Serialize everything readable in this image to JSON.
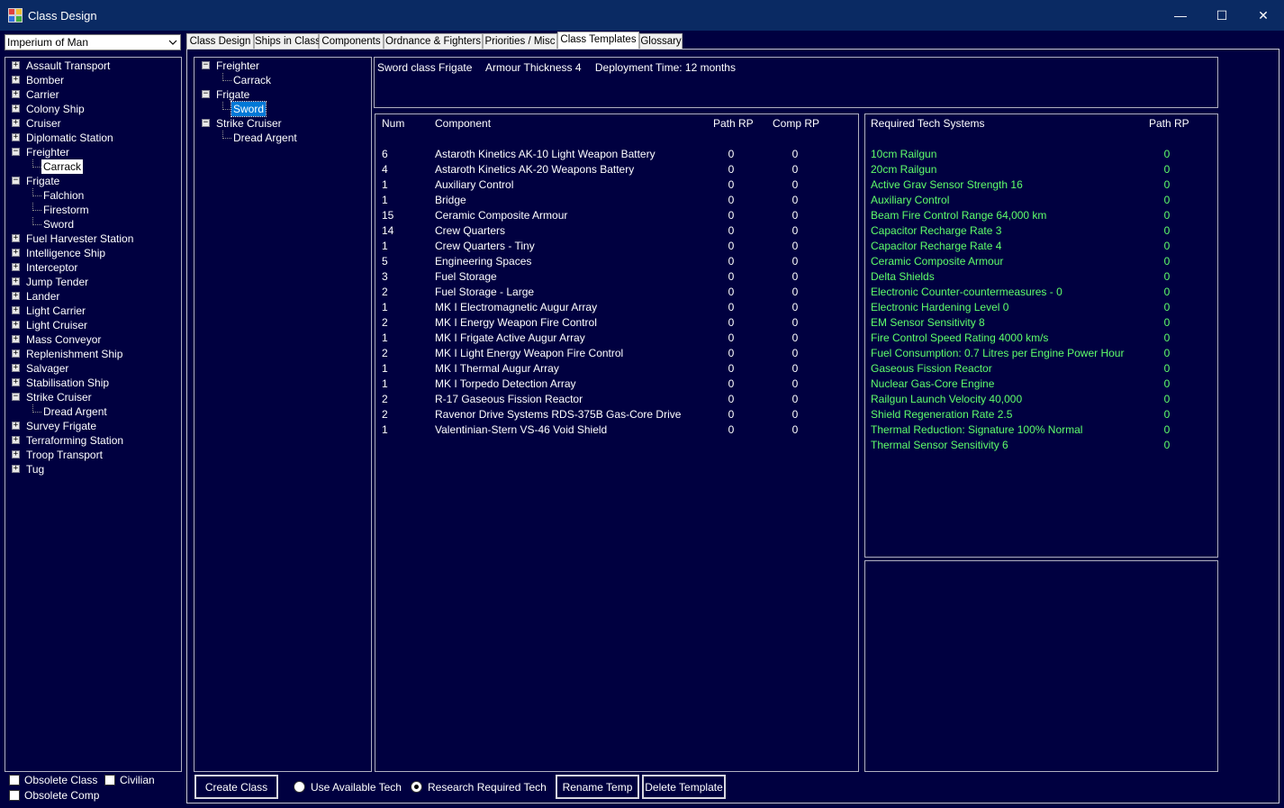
{
  "window": {
    "title": "Class Design",
    "minimize_glyph": "—",
    "maximize_glyph": "☐",
    "close_glyph": "✕"
  },
  "faction_select": {
    "value": "Imperium of Man",
    "arrow": "⌄"
  },
  "left_tree": [
    {
      "label": "Assault Transport",
      "expanded": false,
      "children": []
    },
    {
      "label": "Bomber",
      "expanded": false,
      "children": []
    },
    {
      "label": "Carrier",
      "expanded": false,
      "children": []
    },
    {
      "label": "Colony Ship",
      "expanded": false,
      "children": []
    },
    {
      "label": "Cruiser",
      "expanded": false,
      "children": []
    },
    {
      "label": "Diplomatic Station",
      "expanded": false,
      "children": []
    },
    {
      "label": "Freighter",
      "expanded": true,
      "children": [
        "Carrack"
      ]
    },
    {
      "label": "Frigate",
      "expanded": true,
      "children": [
        "Falchion",
        "Firestorm",
        "Sword"
      ]
    },
    {
      "label": "Fuel Harvester Station",
      "expanded": false,
      "children": []
    },
    {
      "label": "Intelligence Ship",
      "expanded": false,
      "children": []
    },
    {
      "label": "Interceptor",
      "expanded": false,
      "children": []
    },
    {
      "label": "Jump Tender",
      "expanded": false,
      "children": []
    },
    {
      "label": "Lander",
      "expanded": false,
      "children": []
    },
    {
      "label": "Light Carrier",
      "expanded": false,
      "children": []
    },
    {
      "label": "Light Cruiser",
      "expanded": false,
      "children": []
    },
    {
      "label": "Mass Conveyor",
      "expanded": false,
      "children": []
    },
    {
      "label": "Replenishment Ship",
      "expanded": false,
      "children": []
    },
    {
      "label": "Salvager",
      "expanded": false,
      "children": []
    },
    {
      "label": "Stabilisation Ship",
      "expanded": false,
      "children": []
    },
    {
      "label": "Strike Cruiser",
      "expanded": true,
      "children": [
        "Dread Argent"
      ]
    },
    {
      "label": "Survey Frigate",
      "expanded": false,
      "children": []
    },
    {
      "label": "Terraforming Station",
      "expanded": false,
      "children": []
    },
    {
      "label": "Troop Transport",
      "expanded": false,
      "children": []
    },
    {
      "label": "Tug",
      "expanded": false,
      "children": []
    }
  ],
  "left_selected": "Carrack",
  "bottom_checks": {
    "obsolete_class": "Obsolete Class",
    "civilian": "Civilian",
    "obsolete_comp": "Obsolete Comp"
  },
  "tabs": [
    "Class Design",
    "Ships in Class",
    "Components",
    "Ordnance & Fighters",
    "Priorities / Misc",
    "Class Templates",
    "Glossary"
  ],
  "active_tab": "Class Templates",
  "template_tree": [
    {
      "label": "Freighter",
      "children": [
        "Carrack"
      ]
    },
    {
      "label": "Frigate",
      "children": [
        "Sword"
      ]
    },
    {
      "label": "Strike Cruiser",
      "children": [
        "Dread Argent"
      ]
    }
  ],
  "template_selected": "Sword",
  "summary": {
    "class_name": "Sword class Frigate",
    "armour": "Armour Thickness 4",
    "deployment": "Deployment Time: 12 months"
  },
  "components_table": {
    "headers": [
      "Num",
      "Component",
      "Path RP",
      "Comp RP"
    ],
    "rows": [
      [
        "6",
        "Astaroth Kinetics AK-10 Light Weapon Battery",
        "0",
        "0"
      ],
      [
        "4",
        "Astaroth Kinetics AK-20 Weapons Battery",
        "0",
        "0"
      ],
      [
        "1",
        "Auxiliary Control",
        "0",
        "0"
      ],
      [
        "1",
        "Bridge",
        "0",
        "0"
      ],
      [
        "15",
        "Ceramic Composite Armour",
        "0",
        "0"
      ],
      [
        "14",
        "Crew Quarters",
        "0",
        "0"
      ],
      [
        "1",
        "Crew Quarters - Tiny",
        "0",
        "0"
      ],
      [
        "5",
        "Engineering Spaces",
        "0",
        "0"
      ],
      [
        "3",
        "Fuel Storage",
        "0",
        "0"
      ],
      [
        "2",
        "Fuel Storage - Large",
        "0",
        "0"
      ],
      [
        "1",
        "MK I Electromagnetic Augur Array",
        "0",
        "0"
      ],
      [
        "2",
        "MK I Energy Weapon Fire Control",
        "0",
        "0"
      ],
      [
        "1",
        "MK I Frigate Active Augur Array",
        "0",
        "0"
      ],
      [
        "2",
        "MK I Light Energy Weapon Fire Control",
        "0",
        "0"
      ],
      [
        "1",
        "MK I Thermal Augur Array",
        "0",
        "0"
      ],
      [
        "1",
        "MK I Torpedo Detection Array",
        "0",
        "0"
      ],
      [
        "2",
        "R-17 Gaseous Fission Reactor",
        "0",
        "0"
      ],
      [
        "2",
        "Ravenor Drive Systems RDS-375B Gas-Core Drive",
        "0",
        "0"
      ],
      [
        "1",
        "Valentinian-Stern VS-46 Void Shield",
        "0",
        "0"
      ]
    ]
  },
  "tech_table": {
    "headers": [
      "Required Tech Systems",
      "Path RP"
    ],
    "rows": [
      [
        "10cm Railgun",
        "0"
      ],
      [
        "20cm Railgun",
        "0"
      ],
      [
        "Active Grav Sensor Strength 16",
        "0"
      ],
      [
        "Auxiliary Control",
        "0"
      ],
      [
        "Beam Fire Control Range 64,000 km",
        "0"
      ],
      [
        "Capacitor Recharge Rate 3",
        "0"
      ],
      [
        "Capacitor Recharge Rate 4",
        "0"
      ],
      [
        "Ceramic Composite Armour",
        "0"
      ],
      [
        "Delta Shields",
        "0"
      ],
      [
        "Electronic Counter-countermeasures - 0",
        "0"
      ],
      [
        "Electronic Hardening Level 0",
        "0"
      ],
      [
        "EM Sensor Sensitivity 8",
        "0"
      ],
      [
        "Fire Control Speed Rating 4000 km/s",
        "0"
      ],
      [
        "Fuel Consumption: 0.7 Litres per Engine Power Hour",
        "0"
      ],
      [
        "Gaseous Fission Reactor",
        "0"
      ],
      [
        "Nuclear Gas-Core Engine",
        "0"
      ],
      [
        "Railgun Launch Velocity 40,000",
        "0"
      ],
      [
        "Shield Regeneration Rate 2.5",
        "0"
      ],
      [
        "Thermal Reduction: Signature 100% Normal",
        "0"
      ],
      [
        "Thermal Sensor Sensitivity 6",
        "0"
      ]
    ]
  },
  "buttons": {
    "create_class": "Create Class",
    "use_available_tech": "Use Available Tech",
    "research_required_tech": "Research Required Tech",
    "rename_temp": "Rename Temp",
    "delete_template": "Delete Template"
  },
  "colors": {
    "background": "#000040",
    "tech_text": "#5fff6a",
    "titlebar": "#0a2a63"
  }
}
